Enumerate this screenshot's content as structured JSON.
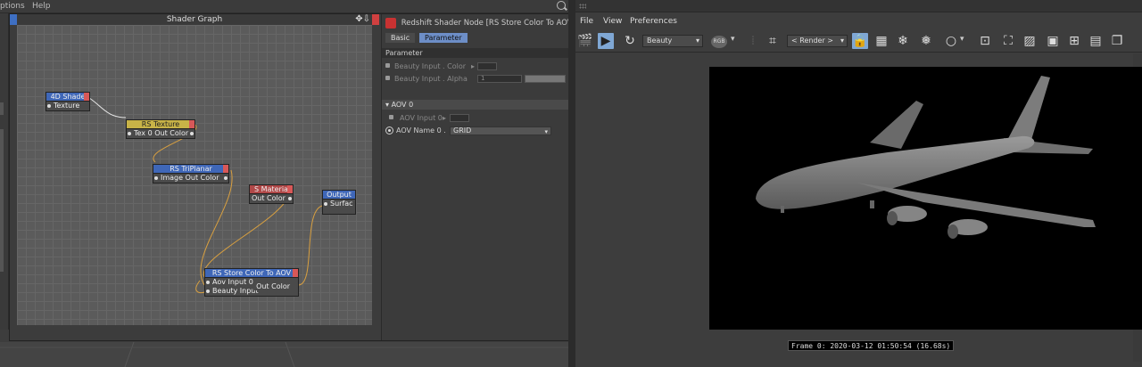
{
  "left_menu": {
    "options": "ptions",
    "help": "Help"
  },
  "shader_graph": {
    "title": "Shader Graph",
    "nodes": {
      "c4d_shader": {
        "title": "4D Shade",
        "port_out": "Texture",
        "color": "#3f67b8"
      },
      "rs_texture": {
        "title": "RS Texture",
        "port": "Tex 0 Out Color",
        "color": "#c8b347"
      },
      "rs_triplanar": {
        "title": "RS TriPlanar",
        "port": "Image  Out Color",
        "color": "#3f67b8"
      },
      "rs_material": {
        "title": "S Materia",
        "port": "Out Color",
        "color": "#b04848"
      },
      "output": {
        "title": "Output",
        "port": "Surfac",
        "color": "#3f67b8"
      },
      "rs_store": {
        "title": "RS Store Color To AOV",
        "port1": "Aov Input 0",
        "port2": "Beauty Input",
        "port_out": "Out Color",
        "color": "#3f67b8"
      }
    }
  },
  "attributes": {
    "title": "Redshift Shader Node [RS Store Color To AOV]",
    "tabs": {
      "basic": "Basic",
      "parameter": "Parameter"
    },
    "section": "Parameter",
    "beauty_color": "Beauty Input . Color",
    "beauty_alpha": "Beauty Input . Alpha",
    "alpha_value": "1",
    "aov_section": "AOV 0",
    "aov_input": "AOV Input 0",
    "aov_name_label": "AOV Name 0 .",
    "aov_name_value": "GRID"
  },
  "render_view": {
    "menu": {
      "file": "File",
      "view": "View",
      "preferences": "Preferences"
    },
    "aov_select": "Beauty",
    "channel_button": "RGB",
    "render_select": "< Render >",
    "frame_info": "Frame 0: 2020-03-12 01:50:54 (16.68s)"
  }
}
